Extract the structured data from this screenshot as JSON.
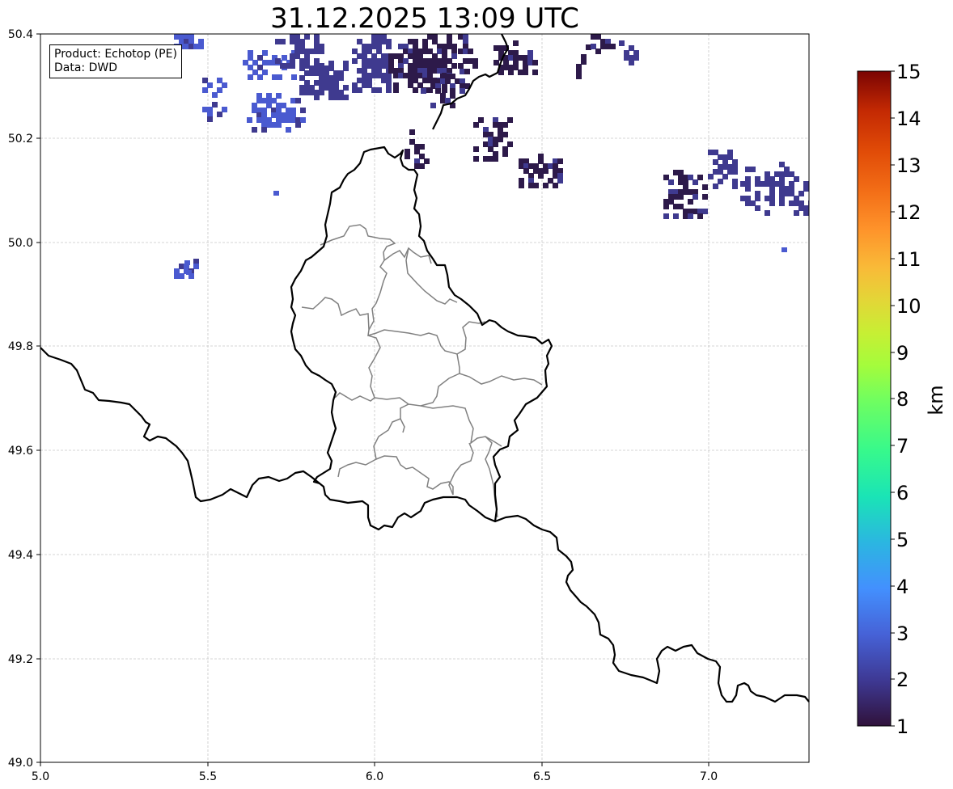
{
  "title": "31.12.2025 13:09 UTC",
  "info": {
    "product_line": "Product: Echotop (PE)",
    "data_line": "Data: DWD"
  },
  "axes": {
    "x_ticks": [
      "5.0",
      "5.5",
      "6.0",
      "6.5",
      "7.0"
    ],
    "y_ticks": [
      "50.4",
      "50.2",
      "50.0",
      "49.8",
      "49.6",
      "49.4",
      "49.2",
      "49.0"
    ],
    "xlim": [
      5.0,
      7.3
    ],
    "ylim": [
      49.0,
      50.4
    ],
    "grid": true
  },
  "colorbar": {
    "unit": "km",
    "ticks": [
      "15",
      "14",
      "13",
      "12",
      "11",
      "10",
      "9",
      "8",
      "7",
      "6",
      "5",
      "4",
      "3",
      "2",
      "1"
    ],
    "range": [
      1,
      15
    ],
    "colors": [
      "#30123b",
      "#3e3994",
      "#4662d7",
      "#4390fe",
      "#2bb6e1",
      "#1ae4b6",
      "#37f98c",
      "#72fe5e",
      "#a4fc3c",
      "#c7ef34",
      "#e3d637",
      "#f9ba38",
      "#fe922a",
      "#f26c16",
      "#e04a07",
      "#c32903",
      "#a01201",
      "#7a0403"
    ]
  },
  "echo_colors": {
    "dark": "#2d1a4a",
    "mid": "#3f3a8f",
    "light": "#4a5ad0"
  }
}
